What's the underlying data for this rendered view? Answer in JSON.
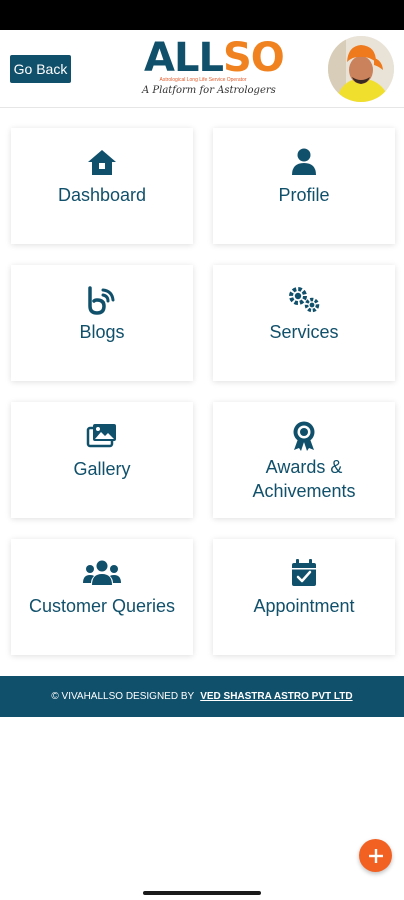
{
  "header": {
    "back_label": "Go Back",
    "logo": {
      "part1": "ALL",
      "part2": "SO",
      "subtitle": "Astrological Long Life Service Operator",
      "tagline": "A Platform for Astrologers"
    },
    "avatar_icon": "profile-photo"
  },
  "menu": {
    "items": [
      {
        "label": "Dashboard",
        "icon": "home-icon"
      },
      {
        "label": "Profile",
        "icon": "user-icon"
      },
      {
        "label": "Blogs",
        "icon": "blog-icon"
      },
      {
        "label": "Services",
        "icon": "cogs-icon"
      },
      {
        "label": "Gallery",
        "icon": "images-icon"
      },
      {
        "label": "Awards &\nAchivements",
        "icon": "award-icon"
      },
      {
        "label": "Customer Queries",
        "icon": "users-icon"
      },
      {
        "label": "Appointment",
        "icon": "calendar-check-icon"
      }
    ]
  },
  "footer": {
    "text": "© VIVAHALLSO DESIGNED BY",
    "link": "VED SHASTRA ASTRO PVT LTD"
  },
  "fab": {
    "icon": "plus-icon"
  },
  "colors": {
    "primary": "#11506b",
    "accent": "#f0821f",
    "fab": "#f26122"
  }
}
